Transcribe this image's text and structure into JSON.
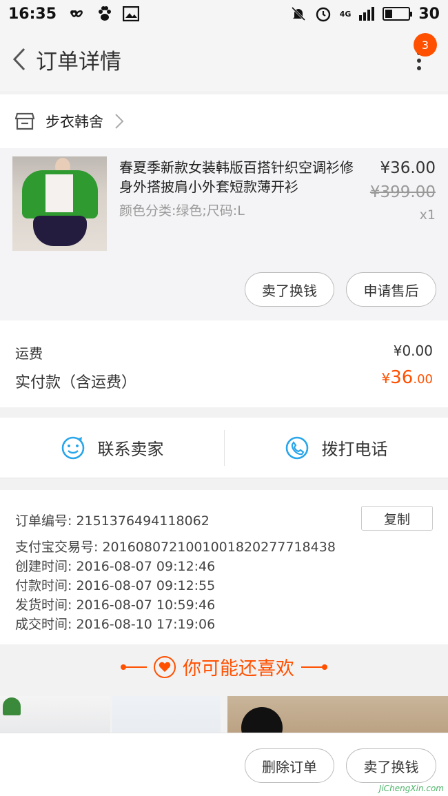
{
  "status_bar": {
    "time": "16:35",
    "battery": "30",
    "network": "4G"
  },
  "header": {
    "title": "订单详情",
    "badge_count": "3"
  },
  "shop": {
    "name": "步衣韩舍"
  },
  "product": {
    "title": "春夏季新款女装韩版百搭针织空调衫修身外搭披肩小外套短款薄开衫",
    "sku": "颜色分类:绿色;尺码:L",
    "price": "¥36.00",
    "original_price": "¥399.00",
    "quantity": "x1",
    "actions": {
      "sell": "卖了换钱",
      "after_sale": "申请售后"
    }
  },
  "cost": {
    "shipping_label": "运费",
    "shipping_value": "¥0.00",
    "paid_label": "实付款（含运费）",
    "paid_symbol": "¥",
    "paid_int": "36",
    "paid_dec": ".00"
  },
  "contact": {
    "seller": "联系卖家",
    "phone": "拨打电话"
  },
  "order_info": {
    "copy_label": "复制",
    "rows": [
      "订单编号:   2151376494118062",
      "支付宝交易号:   2016080721001001820277718438",
      "创建时间:   2016-08-07 09:12:46",
      "付款时间:   2016-08-07 09:12:55",
      "发货时间:   2016-08-07 10:59:46",
      "成交时间:   2016-08-10 17:19:06"
    ]
  },
  "recommend": {
    "title": "你可能还喜欢"
  },
  "bottom_bar": {
    "delete": "删除订单",
    "sell": "卖了换钱"
  },
  "watermark": "JiChengXin.com",
  "colors": {
    "accent": "#ff5000",
    "icon_blue": "#2aa6ea"
  }
}
